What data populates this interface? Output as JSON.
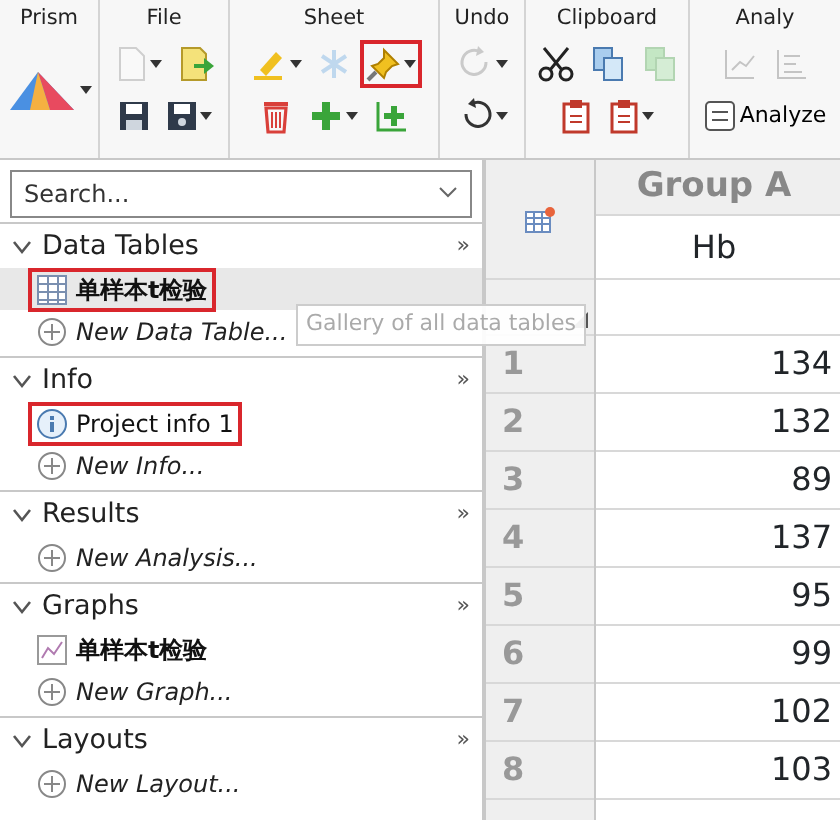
{
  "ribbon": [
    {
      "label": "Prism",
      "rows": [
        [
          {
            "kind": "prism-logo",
            "dropdown": true,
            "disabled": false,
            "highlighted": false
          }
        ]
      ]
    },
    {
      "label": "File",
      "rows": [
        [
          {
            "kind": "new-file",
            "dropdown": true,
            "disabled": true,
            "highlighted": false
          },
          {
            "kind": "open-file",
            "dropdown": false,
            "disabled": false,
            "highlighted": false
          }
        ],
        [
          {
            "kind": "save",
            "dropdown": false,
            "disabled": false,
            "highlighted": false
          },
          {
            "kind": "save-as",
            "dropdown": true,
            "disabled": false,
            "highlighted": false
          }
        ]
      ]
    },
    {
      "label": "Sheet",
      "rows": [
        [
          {
            "kind": "highlighter",
            "dropdown": true,
            "disabled": false,
            "highlighted": false
          },
          {
            "kind": "snowflake",
            "dropdown": false,
            "disabled": true,
            "highlighted": false
          },
          {
            "kind": "pin",
            "dropdown": true,
            "disabled": false,
            "highlighted": true
          }
        ],
        [
          {
            "kind": "trash",
            "dropdown": false,
            "disabled": false,
            "highlighted": false
          },
          {
            "kind": "plus",
            "dropdown": true,
            "disabled": false,
            "highlighted": false
          },
          {
            "kind": "add-column",
            "dropdown": false,
            "disabled": false,
            "highlighted": false
          }
        ]
      ]
    },
    {
      "label": "Undo",
      "rows": [
        [
          {
            "kind": "redo",
            "dropdown": true,
            "disabled": true,
            "highlighted": false
          }
        ],
        [
          {
            "kind": "undo",
            "dropdown": true,
            "disabled": false,
            "highlighted": false
          }
        ]
      ]
    },
    {
      "label": "Clipboard",
      "rows": [
        [
          {
            "kind": "cut",
            "dropdown": false,
            "disabled": false,
            "highlighted": false
          },
          {
            "kind": "copy",
            "dropdown": false,
            "disabled": false,
            "highlighted": false
          },
          {
            "kind": "copy-all",
            "dropdown": false,
            "disabled": true,
            "highlighted": false
          }
        ],
        [
          {
            "kind": "paste",
            "dropdown": false,
            "disabled": false,
            "highlighted": false
          },
          {
            "kind": "paste-special",
            "dropdown": true,
            "disabled": false,
            "highlighted": false
          }
        ]
      ]
    },
    {
      "label": "Analy",
      "rows": [
        [
          {
            "kind": "chart-a",
            "dropdown": false,
            "disabled": true,
            "highlighted": false
          },
          {
            "kind": "chart-b",
            "dropdown": false,
            "disabled": true,
            "highlighted": false
          }
        ],
        [
          {
            "kind": "analyze",
            "label": "Analyze",
            "dropdown": false,
            "disabled": false,
            "highlighted": false
          }
        ]
      ]
    }
  ],
  "search": {
    "placeholder": "Search..."
  },
  "sections": [
    {
      "title": "Data Tables",
      "more": "»",
      "expanded": true,
      "items": [
        {
          "kind": "table",
          "label": "单样本t检验",
          "selected": true,
          "highlighted": true
        },
        {
          "kind": "new",
          "label": "New Data Table...",
          "selected": false,
          "highlighted": false
        }
      ]
    },
    {
      "title": "Info",
      "more": "»",
      "expanded": true,
      "items": [
        {
          "kind": "info",
          "label": "Project info 1",
          "selected": false,
          "highlighted": true
        },
        {
          "kind": "new",
          "label": "New Info...",
          "selected": false,
          "highlighted": false
        }
      ]
    },
    {
      "title": "Results",
      "more": "»",
      "expanded": true,
      "items": [
        {
          "kind": "new",
          "label": "New Analysis...",
          "selected": false,
          "highlighted": false
        }
      ]
    },
    {
      "title": "Graphs",
      "more": "»",
      "expanded": true,
      "items": [
        {
          "kind": "graph",
          "label": "单样本t检验",
          "selected": false,
          "highlighted": false
        },
        {
          "kind": "new",
          "label": "New Graph...",
          "selected": false,
          "highlighted": false
        }
      ]
    },
    {
      "title": "Layouts",
      "more": "»",
      "expanded": true,
      "items": [
        {
          "kind": "new",
          "label": "New Layout...",
          "selected": false,
          "highlighted": false
        }
      ]
    }
  ],
  "tooltip": {
    "text": "Gallery of all data tables"
  },
  "table": {
    "column_title": "Group A",
    "column_subtitle": "Hb",
    "rows": [
      {
        "number": "1",
        "value": "134"
      },
      {
        "number": "2",
        "value": "132"
      },
      {
        "number": "3",
        "value": "89"
      },
      {
        "number": "4",
        "value": "137"
      },
      {
        "number": "5",
        "value": "95"
      },
      {
        "number": "6",
        "value": "99"
      },
      {
        "number": "7",
        "value": "102"
      },
      {
        "number": "8",
        "value": "103"
      }
    ]
  }
}
